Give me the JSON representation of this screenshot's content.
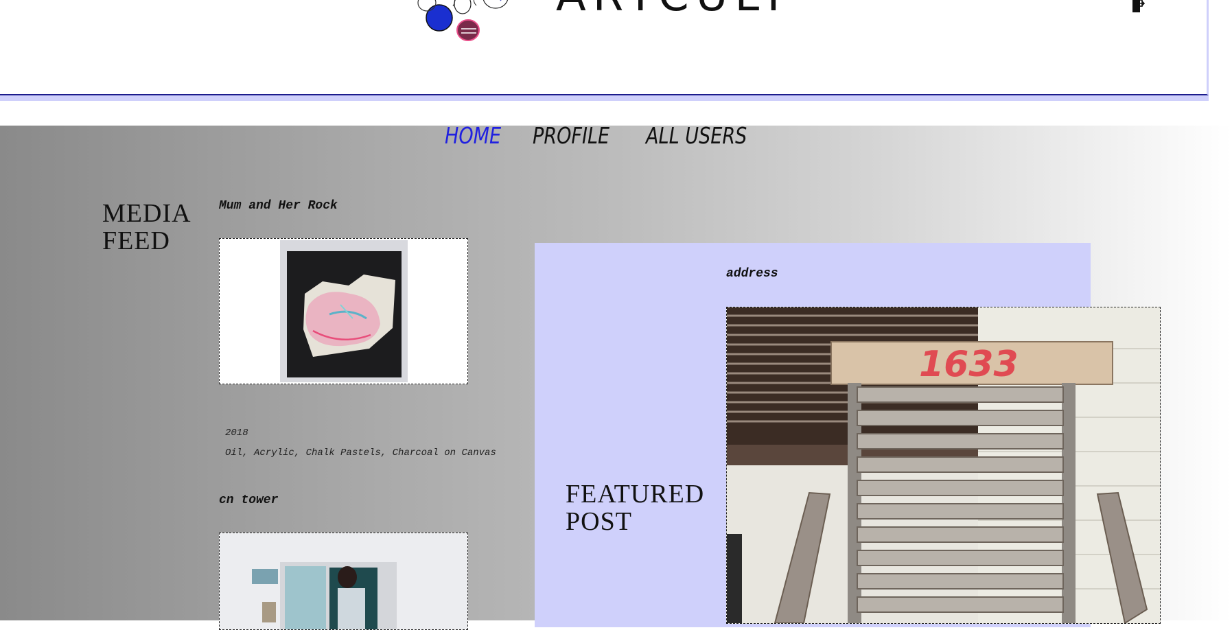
{
  "header": {
    "site_title": "ARTCULT",
    "logout_icon": "logout-door-icon"
  },
  "nav": {
    "items": [
      {
        "label": "HOME",
        "active": true
      },
      {
        "label": "PROFILE",
        "active": false
      },
      {
        "label": "ALL USERS",
        "active": false
      }
    ]
  },
  "media_feed": {
    "title": "MEDIA FEED",
    "posts": [
      {
        "title": "Mum and Her Rock",
        "year": "2018",
        "medium": "Oil, Acrylic, Chalk Pastels, Charcoal on Canvas"
      },
      {
        "title": "cn tower"
      }
    ]
  },
  "featured": {
    "title": "FEATURED POST",
    "post_title": "address"
  },
  "colors": {
    "accent_nav": "#2020e0",
    "panel_lavender": "#cfd0fb",
    "header_border": "#1b1b8c"
  }
}
